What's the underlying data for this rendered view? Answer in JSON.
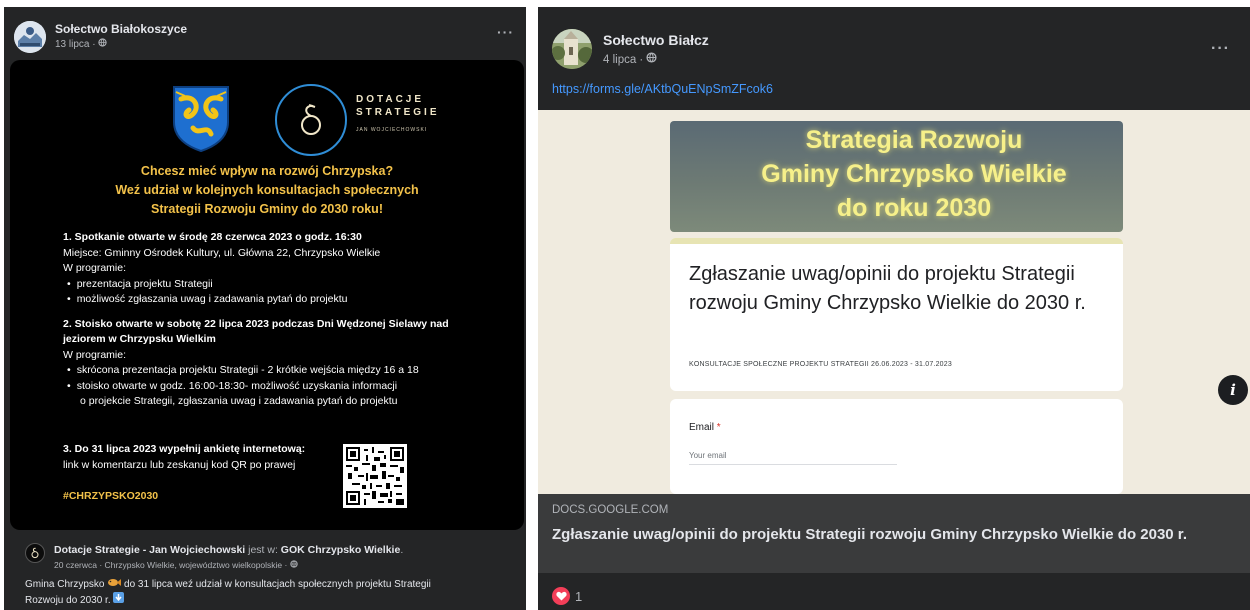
{
  "left_post": {
    "author": "Sołectwo Białokoszyce",
    "date": "13 lipca · ",
    "privacy_icon": "globe-icon",
    "more_icon": "more-dots-icon",
    "more_label": "···",
    "flyer": {
      "logo_line1": "DOTACJE",
      "logo_line2": "STRATEGIE",
      "logo_line3": "JAN WOJCIECHOWSKI",
      "headline": [
        "Chcesz mieć wpływ na rozwój Chrzypska?",
        "Weź udział w kolejnych konsultacjach społecznych",
        "Strategii Rozwoju Gminy do 2030 roku!"
      ],
      "point1_title": "1. Spotkanie otwarte w środę 28 czerwca 2023 o godz. 16:30",
      "point1_place": "Miejsce: Gminny Ośrodek Kultury, ul. Główna 22, Chrzypsko Wielkie",
      "point1_program": "W programie:",
      "point1_items": [
        "prezentacja projektu Strategii",
        "możliwość zgłaszania uwag i zadawania pytań do projektu"
      ],
      "point2_title_l1": "2. Stoisko otwarte w sobotę 22 lipca 2023 podczas Dni Wędzonej Sielawy nad",
      "point2_title_l2": "jeziorem w Chrzypsku Wielkim",
      "point2_program": "W programie:",
      "point2_item1": "skrócona prezentacja projektu Strategii - 2 krótkie wejścia między 16 a 18",
      "point2_item2": "stoisko otwarte w godz. 16:00-18:30- możliwość uzyskania informacji",
      "point2_item2_cont": "o projekcie Strategii, zgłaszania uwag i zadawania pytań do projektu",
      "point3_l1": "3. Do 31 lipca 2023 wypełnij ankietę internetową:",
      "point3_l2": "link w komentarzu lub zeskanuj kod QR po prawej",
      "hashtag": "#CHRZYPSKO2030"
    },
    "shared_by": "Dotacje Strategie - Jan Wojciechowski",
    "shared_mid": " jest w: ",
    "shared_place": "GOK Chrzypsko Wielkie",
    "shared_end": ".",
    "shared_meta": "20 czerwca · Chrzypsko Wielkie, województwo wielkopolskie · ",
    "text_before_emoji": "Gmina Chrzypsko ",
    "text_after_emoji": " do 31 lipca weź udział w konsultacjach społecznych projektu Strategii",
    "text_line2": "Rozwoju do 2030 r. "
  },
  "right_post": {
    "author": "Sołectwo Białcz",
    "date": "4 lipca · ",
    "privacy_icon": "globe-icon",
    "more_label": "···",
    "link_url": "https://forms.gle/AKtbQuENpSmZFcok6",
    "preview": {
      "banner_lines": [
        "Strategia Rozwoju",
        "Gminy Chrzypsko Wielkie",
        "do roku 2030"
      ],
      "form_title": "Zgłaszanie uwag/opinii do projektu Strategii rozwoju Gminy Chrzypsko Wielkie do 2030 r.",
      "form_subtitle": "KONSULTACJE SPOŁECZNE PROJEKTU STRATEGII 26.06.2023 - 31.07.2023",
      "email_label": "Email",
      "email_required": " *",
      "email_placeholder": "Your email"
    },
    "domain": "DOCS.GOOGLE.COM",
    "link_title": "Zgłaszanie uwag/opinii do projektu Strategii rozwoju Gminy Chrzypsko Wielkie do 2030 r.",
    "reaction_count": "1",
    "info_label": "i"
  },
  "colors": {
    "card_bg": "#242526",
    "flyer_bg": "#000000",
    "flyer_accent": "#f3c24a",
    "link_blue": "#4599ff",
    "heart_red": "#f33e58"
  }
}
